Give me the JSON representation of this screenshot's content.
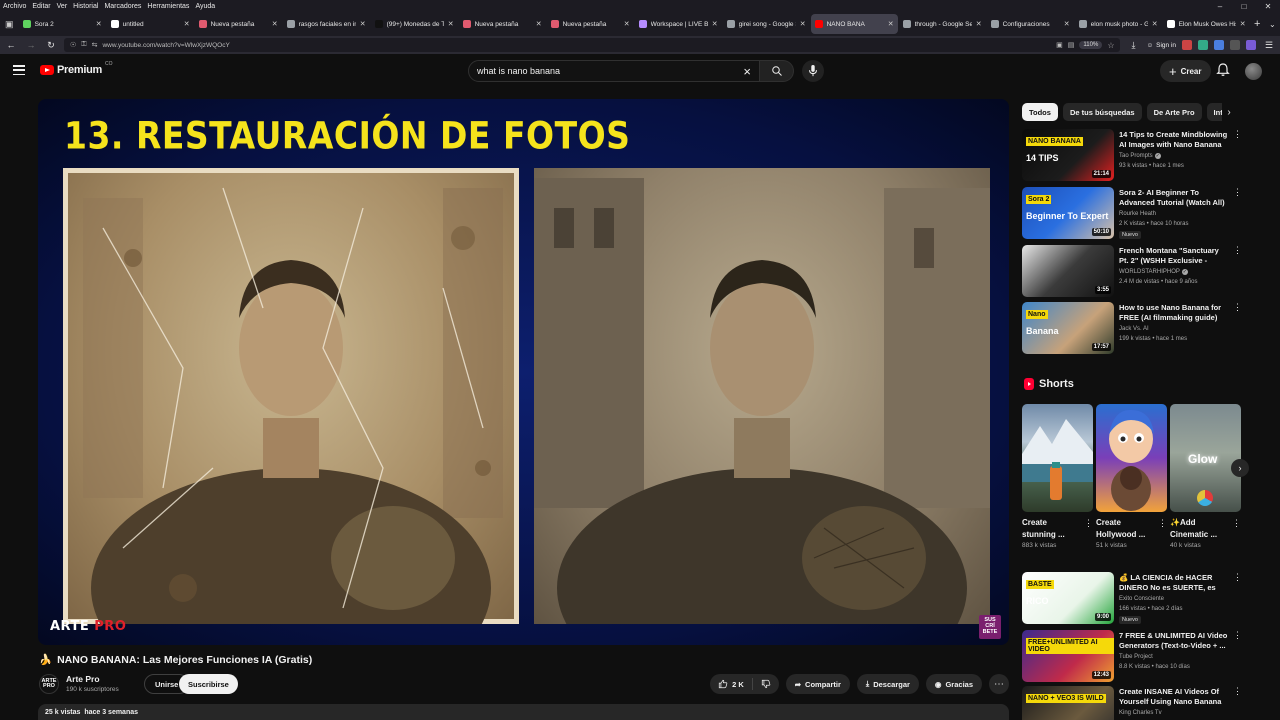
{
  "menubar": {
    "items": [
      "Archivo",
      "Editar",
      "Ver",
      "Historial",
      "Marcadores",
      "Herramientas",
      "Ayuda"
    ]
  },
  "tabs": [
    {
      "title": "Sora 2",
      "color": "#5fd35f",
      "active": false
    },
    {
      "title": "untitled",
      "color": "#ffffff",
      "active": false
    },
    {
      "title": "Nueva pestaña",
      "color": "#e05a6f",
      "active": false
    },
    {
      "title": "rasgos faciales en ingl",
      "color": "#9aa0a6",
      "active": false
    },
    {
      "title": "(99+) Monedas de TikT",
      "color": "#111111",
      "active": false
    },
    {
      "title": "Nueva pestaña",
      "color": "#e05a6f",
      "active": false
    },
    {
      "title": "Nueva pestaña",
      "color": "#e05a6f",
      "active": false
    },
    {
      "title": "Workspace | LIVE Back",
      "color": "#b58cff",
      "active": false
    },
    {
      "title": "girei song - Google S",
      "color": "#9aa0a6",
      "active": false
    },
    {
      "title": "NANO BANA",
      "color": "#ff0000",
      "active": true
    },
    {
      "title": "through - Google Sea",
      "color": "#9aa0a6",
      "active": false
    },
    {
      "title": "Configuraciones",
      "color": "#9aa0a6",
      "active": false
    },
    {
      "title": "elon musk photo - Go",
      "color": "#9aa0a6",
      "active": false
    },
    {
      "title": "Elon Musk Owes His S",
      "color": "#ffffff",
      "active": false
    }
  ],
  "navbar": {
    "url": "www.youtube.com/watch?v=WlwXjzWQOcY",
    "zoom": "110%",
    "signin": "Sign in"
  },
  "header": {
    "logo_text": "Premium",
    "country": "CO",
    "search_value": "what is nano banana",
    "create_label": "Crear"
  },
  "player": {
    "overlay_title": "13. RESTAURACIÓN DE FOTOS",
    "brand_a": "ARTE",
    "brand_b": "PRO",
    "subscribe_badge": [
      "SUS",
      "CRÍ",
      "BETE"
    ]
  },
  "video": {
    "emoji": "🍌",
    "title": "NANO BANANA: Las Mejores Funciones IA (Gratis)",
    "channel_avatar_text": "ARTE PRO",
    "channel": "Arte Pro",
    "subscribers": "190 k suscriptores",
    "join_label": "Unirse",
    "subscribe_label": "Suscribirse",
    "likes": "2 K",
    "share_label": "Compartir",
    "download_label": "Descargar",
    "thanks_label": "Gracias",
    "views": "25 k vistas",
    "age": "hace 3 semanas"
  },
  "chips": [
    "Todos",
    "De tus búsquedas",
    "De Arte Pro",
    "Inte"
  ],
  "recommendations": [
    {
      "title": "14 Tips to Create Mindblowing AI Images with Nano Banana ...",
      "channel": "Tao Prompts",
      "verified": true,
      "views": "93 k vistas",
      "age": "hace 1 mes",
      "duration": "21:14",
      "badge": "",
      "thumb_text_a": "NANO BANANA",
      "thumb_text_b": "14 TIPS"
    },
    {
      "title": "Sora 2- AI Beginner To Advanced Tutorial (Watch All)",
      "channel": "Rourke Heath",
      "verified": false,
      "views": "2 K vistas",
      "age": "hace 10 horas",
      "duration": "50:10",
      "badge": "Nuevo",
      "thumb_text_a": "Sora 2",
      "thumb_text_b": "Beginner To Expert"
    },
    {
      "title": "French Montana \"Sanctuary Pt. 2\" (WSHH Exclusive - Official ...",
      "channel": "WORLDSTARHIPHOP",
      "verified": true,
      "views": "2.4 M de vistas",
      "age": "hace 9 años",
      "duration": "3:55",
      "badge": "",
      "thumb_text_a": "",
      "thumb_text_b": ""
    },
    {
      "title": "How to use Nano Banana for FREE (AI filmmaking guide)",
      "channel": "Jack Vs. AI",
      "verified": false,
      "views": "199 k vistas",
      "age": "hace 1 mes",
      "duration": "17:57",
      "badge": "",
      "thumb_text_a": "Nano",
      "thumb_text_b": "Banana"
    }
  ],
  "shorts": {
    "heading": "Shorts",
    "items": [
      {
        "title": "Create stunning ...",
        "views": "883 k vistas"
      },
      {
        "title": "Create Hollywood ...",
        "views": "51 k vistas"
      },
      {
        "title": "✨Add Cinematic ...",
        "views": "40 k vistas",
        "thumb_text": "Glow"
      }
    ]
  },
  "recommendations2": [
    {
      "title": "💰 LA CIENCIA de HACER DINERO No es SUERTE, es una...",
      "channel": "Exito Consciente",
      "verified": false,
      "views": "166 vistas",
      "age": "hace 2 días",
      "duration": "9:00",
      "badge": "Nuevo",
      "thumb_text_a": "BASTE",
      "thumb_text_b": "RICO"
    },
    {
      "title": "7 FREE & UNLIMITED AI Video Generators (Text-to-Video + ...",
      "channel": "Tube Project",
      "verified": false,
      "views": "8.8 K vistas",
      "age": "hace 10 días",
      "duration": "12:43",
      "badge": "",
      "thumb_text_a": "FREE+UNLIMITED AI VIDEO",
      "thumb_text_b": ""
    },
    {
      "title": "Create INSANE AI Videos Of Yourself Using Nano Banana &...",
      "channel": "King Charles Tv",
      "verified": false,
      "views": "",
      "age": "",
      "duration": "",
      "badge": "",
      "thumb_text_a": "NANO + VEO3 IS WILD",
      "thumb_text_b": ""
    }
  ],
  "colors": {
    "accent": "#ff0000",
    "title_yellow": "#f5e31c",
    "background": "#0f0f0f"
  }
}
